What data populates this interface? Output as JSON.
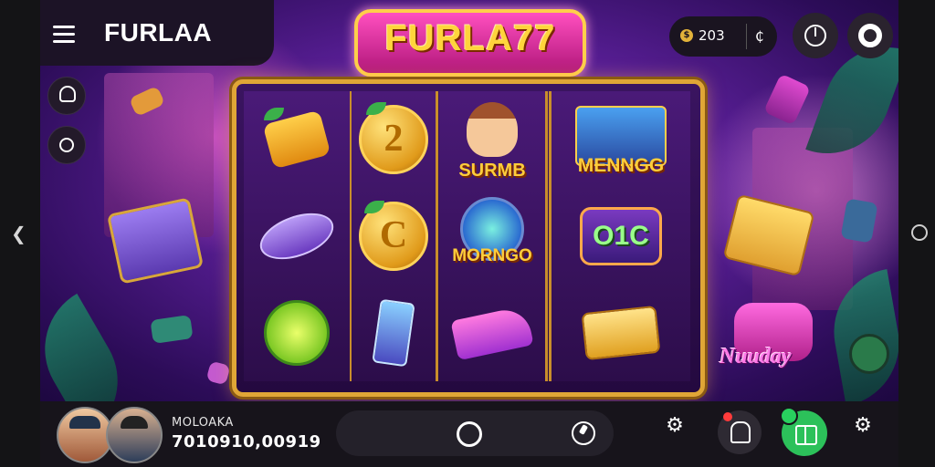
{
  "header": {
    "brand_label": "FURLAA",
    "logo_text": "FURLA77",
    "balance_value": "203",
    "coin_symbol": "$",
    "wallet_symbol": "₵"
  },
  "reels": {
    "symbol_labels": {
      "r3_c1": "SURMB",
      "r3_c2": "MORNGO",
      "r4_c1": "MENNGG",
      "r4_c2": "O1C",
      "r4_c3": "Nuuday"
    },
    "coin_letters": {
      "r2_c1": "2",
      "r2_c2": "C"
    }
  },
  "player": {
    "name": "MOLOAKA",
    "balance": "7010910,00919"
  },
  "colors": {
    "background": "#5a1f98",
    "frame_gold": "#e0a636",
    "logo_pink": "#ff4fbf",
    "gift_green": "#2cc15a"
  },
  "icons": {
    "menu": "hamburger-icon",
    "clock": "clock-icon",
    "record": "record-icon",
    "key": "key-icon",
    "timer": "timer-icon",
    "spin": "spin-icon",
    "autoplay": "autoplay-icon",
    "gear": "gear-icon",
    "bell": "bell-icon",
    "gift": "gift-icon",
    "settings": "settings-icon"
  }
}
